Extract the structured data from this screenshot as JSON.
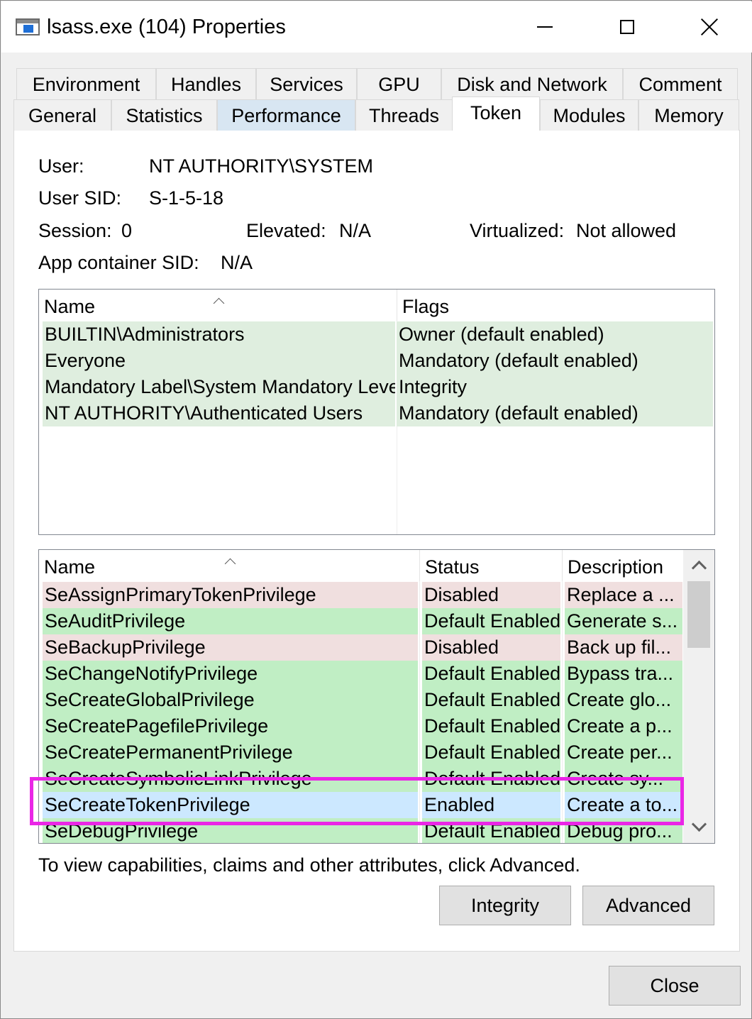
{
  "window": {
    "title": "lsass.exe (104) Properties",
    "caption_buttons": {
      "minimize": "minimize-icon",
      "maximize": "maximize-icon",
      "close": "close-icon"
    }
  },
  "tabs": {
    "row_top": [
      "Environment",
      "Handles",
      "Services",
      "GPU",
      "Disk and Network",
      "Comment"
    ],
    "row_bottom": [
      "General",
      "Statistics",
      "Performance",
      "Threads",
      "Token",
      "Modules",
      "Memory"
    ],
    "active": "Token",
    "hovered": "Performance"
  },
  "token": {
    "user_label": "User:",
    "user_value": "NT AUTHORITY\\SYSTEM",
    "sid_label": "User SID:",
    "sid_value": "S-1-5-18",
    "session_label": "Session:",
    "session_value": "0",
    "elevated_label": "Elevated:",
    "elevated_value": "N/A",
    "virtualized_label": "Virtualized:",
    "virtualized_value": "Not allowed",
    "app_container_label": "App container SID:",
    "app_container_value": "N/A"
  },
  "groups": {
    "columns": [
      "Name",
      "Flags"
    ],
    "rows": [
      {
        "name": "BUILTIN\\Administrators",
        "flags": "Owner (default enabled)"
      },
      {
        "name": "Everyone",
        "flags": "Mandatory (default enabled)"
      },
      {
        "name": "Mandatory Label\\System Mandatory Level",
        "flags": "Integrity"
      },
      {
        "name": "NT AUTHORITY\\Authenticated Users",
        "flags": "Mandatory (default enabled)"
      }
    ]
  },
  "privileges": {
    "columns": [
      "Name",
      "Status",
      "Description"
    ],
    "rows": [
      {
        "name": "SeAssignPrimaryTokenPrivilege",
        "status": "Disabled",
        "description": "Replace a ..."
      },
      {
        "name": "SeAuditPrivilege",
        "status": "Default Enabled",
        "description": "Generate s..."
      },
      {
        "name": "SeBackupPrivilege",
        "status": "Disabled",
        "description": "Back up fil..."
      },
      {
        "name": "SeChangeNotifyPrivilege",
        "status": "Default Enabled",
        "description": "Bypass tra..."
      },
      {
        "name": "SeCreateGlobalPrivilege",
        "status": "Default Enabled",
        "description": "Create glo..."
      },
      {
        "name": "SeCreatePagefilePrivilege",
        "status": "Default Enabled",
        "description": "Create a p..."
      },
      {
        "name": "SeCreatePermanentPrivilege",
        "status": "Default Enabled",
        "description": "Create per..."
      },
      {
        "name": "SeCreateSymbolicLinkPrivilege",
        "status": "Default Enabled",
        "description": "Create sy..."
      },
      {
        "name": "SeCreateTokenPrivilege",
        "status": "Enabled",
        "description": "Create a to..."
      },
      {
        "name": "SeDebugPrivilege",
        "status": "Default Enabled",
        "description": "Debug pro..."
      }
    ],
    "selected_row": "SeCreateTokenPrivilege"
  },
  "colors": {
    "disabled_row": "#f0dfdf",
    "enabled_row": "#c0eec4",
    "group_row": "#dfeedf",
    "selected_row": "#cce8ff",
    "highlight": "#ea26e6"
  },
  "footer": {
    "hint": "To view capabilities, claims and other attributes, click Advanced.",
    "integrity_button": "Integrity",
    "advanced_button": "Advanced",
    "close_button": "Close"
  }
}
